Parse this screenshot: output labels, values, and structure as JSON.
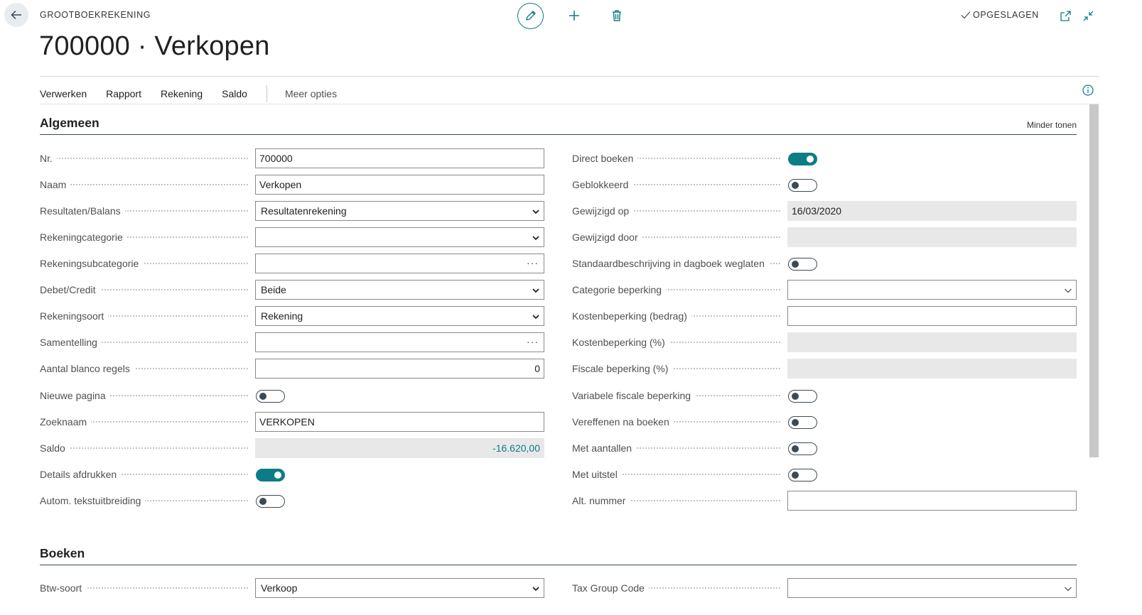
{
  "header": {
    "breadcrumb": "GROOTBOEKREKENING",
    "title": "700000 · Verkopen",
    "saved_label": "OPGESLAGEN"
  },
  "actionbar": {
    "items": [
      "Verwerken",
      "Rapport",
      "Rekening",
      "Saldo"
    ],
    "more": "Meer opties"
  },
  "algemeen": {
    "title": "Algemeen",
    "toggle_link": "Minder tonen",
    "left": {
      "nr_label": "Nr.",
      "nr_value": "700000",
      "naam_label": "Naam",
      "naam_value": "Verkopen",
      "resbal_label": "Resultaten/Balans",
      "resbal_value": "Resultatenrekening",
      "rekcat_label": "Rekeningcategorie",
      "rekcat_value": "",
      "reksubcat_label": "Rekeningsubcategorie",
      "reksubcat_value": "",
      "debcred_label": "Debet/Credit",
      "debcred_value": "Beide",
      "reksoort_label": "Rekeningsoort",
      "reksoort_value": "Rekening",
      "samentelling_label": "Samentelling",
      "samentelling_value": "",
      "blanco_label": "Aantal blanco regels",
      "blanco_value": "0",
      "nieuwe_pagina_label": "Nieuwe pagina",
      "nieuwe_pagina_on": false,
      "zoeknaam_label": "Zoeknaam",
      "zoeknaam_value": "VERKOPEN",
      "saldo_label": "Saldo",
      "saldo_value": "-16.620,00",
      "details_label": "Details afdrukken",
      "details_on": true,
      "autotekst_label": "Autom. tekstuitbreiding",
      "autotekst_on": false
    },
    "right": {
      "direct_label": "Direct boeken",
      "direct_on": true,
      "geblokkeerd_label": "Geblokkeerd",
      "geblokkeerd_on": false,
      "gewijzigd_op_label": "Gewijzigd op",
      "gewijzigd_op_value": "16/03/2020",
      "gewijzigd_door_label": "Gewijzigd door",
      "gewijzigd_door_value": "",
      "standaard_label": "Standaardbeschrijving in dagboek weglaten",
      "standaard_on": false,
      "catbep_label": "Categorie beperking",
      "catbep_value": "",
      "kostbedrag_label": "Kostenbeperking (bedrag)",
      "kostbedrag_value": "",
      "kostpct_label": "Kostenbeperking (%)",
      "kostpct_value": "",
      "fiscaal_label": "Fiscale beperking (%)",
      "fiscaal_value": "",
      "varfiscaal_label": "Variabele fiscale beperking",
      "varfiscaal_on": false,
      "vereffenen_label": "Vereffenen na boeken",
      "vereffenen_on": false,
      "aantallen_label": "Met aantallen",
      "aantallen_on": false,
      "uitstel_label": "Met uitstel",
      "uitstel_on": false,
      "altnr_label": "Alt. nummer",
      "altnr_value": ""
    }
  },
  "boeken": {
    "title": "Boeken",
    "btw_label": "Btw-soort",
    "btw_value": "Verkoop",
    "taxgroup_label": "Tax Group Code",
    "taxgroup_value": ""
  },
  "colors": {
    "accent": "#0c7c86",
    "toggle_off": "#3b4a56",
    "readonly_bg": "#e8e8e8"
  }
}
